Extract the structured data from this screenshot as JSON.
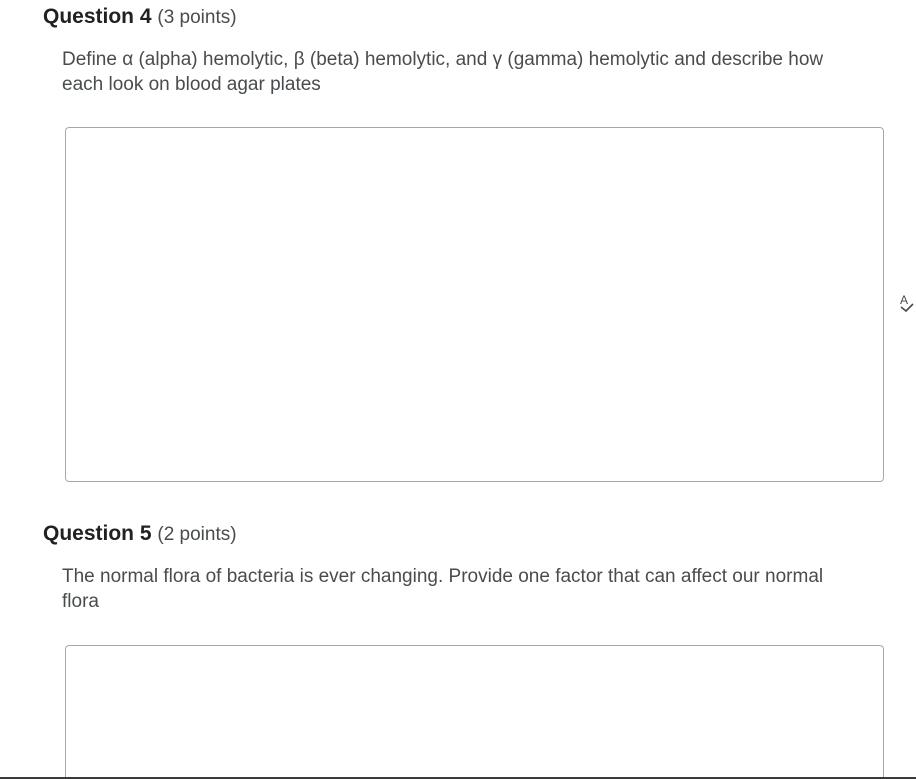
{
  "questions": [
    {
      "title": "Question 4",
      "points": "(3 points)",
      "prompt": "Define α (alpha) hemolytic, β (beta) hemolytic, and γ (gamma) hemolytic and describe how each look on blood agar plates",
      "answer_value": ""
    },
    {
      "title": "Question 5",
      "points": "(2 points)",
      "prompt": "The normal flora of bacteria is ever changing. Provide one factor that can affect our normal flora",
      "answer_value": ""
    }
  ],
  "icons": {
    "spellcheck": "spellcheck-icon"
  },
  "colors": {
    "text": "#494c4e",
    "heading": "#202122",
    "border": "#a6a9ab",
    "background": "#ffffff"
  }
}
